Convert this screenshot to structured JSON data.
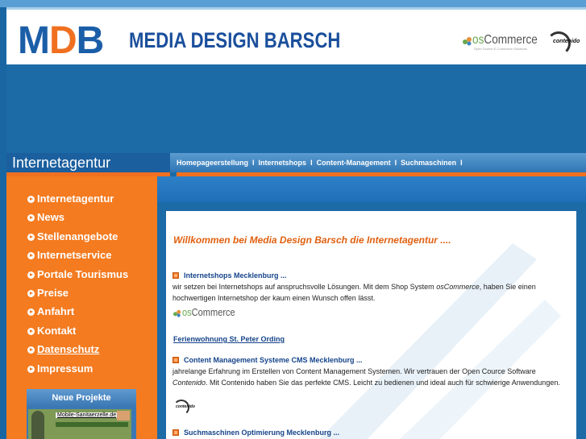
{
  "header": {
    "logo": {
      "m": "M",
      "d": "D",
      "b": "B"
    },
    "title": "MEDIA DESIGN BARSCH",
    "oscommerce": {
      "os": "os",
      "rest": "Commerce",
      "sub": "Open Source E-Commerce Solutions"
    },
    "contenido": "contenido"
  },
  "nav": {
    "title": "Internetagentur",
    "links": [
      "Homepageerstellung",
      "Internetshops",
      "Content-Management",
      "Suchmaschinen"
    ],
    "separator": "I"
  },
  "sidebar": {
    "items": [
      {
        "label": "Internetagentur"
      },
      {
        "label": "News"
      },
      {
        "label": "Stellenangebote"
      },
      {
        "label": "Internetservice"
      },
      {
        "label": "Portale Tourismus"
      },
      {
        "label": "Preise"
      },
      {
        "label": "Anfahrt"
      },
      {
        "label": "Kontakt"
      },
      {
        "label": "Datenschutz"
      },
      {
        "label": "Impressum"
      }
    ],
    "projects": {
      "title": "Neue Projekte",
      "thumb_label": "Mobile-Sanitaerzelle.de"
    }
  },
  "content": {
    "welcome": "Willkommen bei Media Design Barsch die Internetagentur ....",
    "sections": [
      {
        "heading": "Internetshops Mecklenburg ...",
        "text_pre": "wir setzen bei Internetshops auf anspruchsvolle Lösungen. Mit dem Shop System ",
        "text_em": "osCommerce",
        "text_post": ", haben Sie einen hochwertigen Internetshop der kaum einen Wunsch offen lässt."
      },
      {
        "heading": "Content Management Systeme CMS Mecklenburg ...",
        "text_pre": "jahrelange Erfahrung im Erstellen von Content Management Systemen. Wir vertrauen der Open Cource Software ",
        "text_em": "Contenido",
        "text_post": ". Mit Contenido haben Sie das perfekte CMS. Leicht zu bedienen und ideal auch für schwierige Anwendungen."
      },
      {
        "heading": "Suchmaschinen Optimierung Mecklenburg ..."
      }
    ],
    "ferien_link": "Ferienwohnung St. Peter Ording",
    "mini_oscommerce": {
      "os": "os",
      "rest": "Commerce"
    },
    "mini_contenido": "contenido"
  }
}
